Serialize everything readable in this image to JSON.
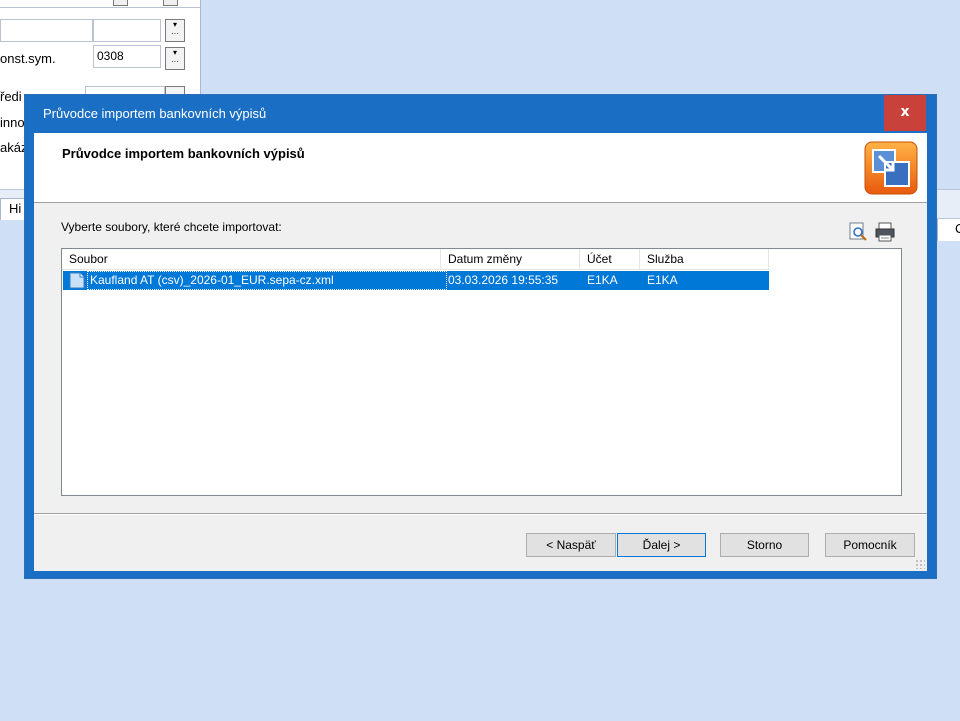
{
  "background": {
    "fields": [
      {
        "label": "onst.sym.",
        "value": "0308"
      }
    ],
    "labels": [
      "ředi",
      "inno",
      "akáz"
    ],
    "tab_label": "Hi",
    "right_strip_text": "C"
  },
  "dialog": {
    "title": "Průvodce importem bankovních výpisů",
    "close_label": "x",
    "header_title": "Průvodce importem bankovních výpisů",
    "prompt": "Vyberte soubory, které chcete importovat:",
    "toolbar_icons": [
      "preview-icon",
      "print-icon"
    ],
    "columns": [
      "Soubor",
      "Datum změny",
      "Účet",
      "Služba"
    ],
    "rows": [
      {
        "file": "Kaufland AT (csv)_2026-01_EUR.sepa-cz.xml",
        "date": "03.03.2026 19:55:35",
        "account": "E1KA",
        "service": "E1KA",
        "selected": true
      }
    ],
    "buttons": {
      "back": "< Naspäť",
      "next": "Ďalej >",
      "cancel": "Storno",
      "help": "Pomocník"
    },
    "colors": {
      "title_bar": "#1a6fc4",
      "close": "#c8413a",
      "selection": "#0078d7",
      "desktop": "#cfdff5"
    }
  }
}
